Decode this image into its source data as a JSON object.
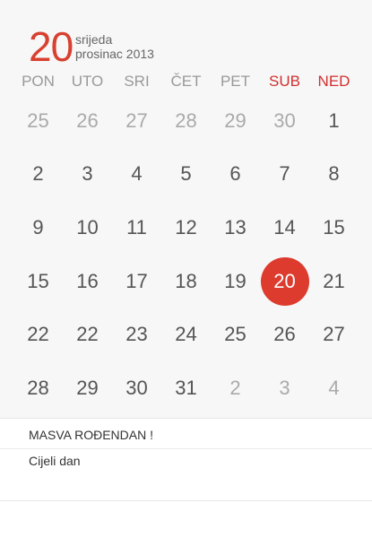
{
  "header": {
    "day": "20",
    "weekday": "srijeda",
    "month_year": "prosinac 2013"
  },
  "weekdays": [
    {
      "label": "PON",
      "weekend": false
    },
    {
      "label": "UTO",
      "weekend": false
    },
    {
      "label": "SRI",
      "weekend": false
    },
    {
      "label": "ČET",
      "weekend": false
    },
    {
      "label": "PET",
      "weekend": false
    },
    {
      "label": "SUB",
      "weekend": true
    },
    {
      "label": "NED",
      "weekend": true
    }
  ],
  "days": [
    {
      "label": "25",
      "muted": true
    },
    {
      "label": "26",
      "muted": true
    },
    {
      "label": "27",
      "muted": true
    },
    {
      "label": "28",
      "muted": true
    },
    {
      "label": "29",
      "muted": true
    },
    {
      "label": "30",
      "muted": true
    },
    {
      "label": "1"
    },
    {
      "label": "2"
    },
    {
      "label": "3"
    },
    {
      "label": "4"
    },
    {
      "label": "5"
    },
    {
      "label": "6"
    },
    {
      "label": "7"
    },
    {
      "label": "8"
    },
    {
      "label": "9"
    },
    {
      "label": "10"
    },
    {
      "label": "11"
    },
    {
      "label": "12"
    },
    {
      "label": "13"
    },
    {
      "label": "14"
    },
    {
      "label": "15"
    },
    {
      "label": "15"
    },
    {
      "label": "16"
    },
    {
      "label": "17"
    },
    {
      "label": "18"
    },
    {
      "label": "19"
    },
    {
      "label": "20",
      "selected": true
    },
    {
      "label": "21"
    },
    {
      "label": "22"
    },
    {
      "label": "22"
    },
    {
      "label": "23"
    },
    {
      "label": "24"
    },
    {
      "label": "25"
    },
    {
      "label": "26"
    },
    {
      "label": "27"
    },
    {
      "label": "28"
    },
    {
      "label": "29"
    },
    {
      "label": "30"
    },
    {
      "label": "31"
    },
    {
      "label": "2",
      "muted": true
    },
    {
      "label": "3",
      "muted": true
    },
    {
      "label": "4",
      "muted": true
    }
  ],
  "event": {
    "title": "MASVA ROĐENDAN !",
    "time": "Cijeli dan"
  },
  "colors": {
    "accent": "#dc3b2e",
    "weekend": "#d32f2f",
    "muted": "#aaaaaa"
  }
}
